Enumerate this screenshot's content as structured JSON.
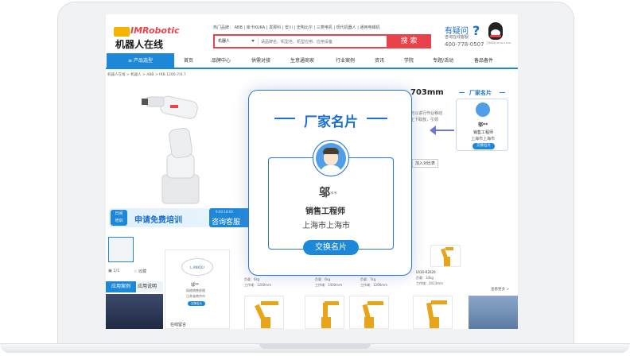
{
  "site": {
    "logo_brand": "IMRobotic",
    "logo_cn": "机器人在线",
    "hot_label": "热门品牌：",
    "hot_brands": [
      "ABB",
      "库卡KUKA",
      "发那科",
      "安川",
      "史陶比尔",
      "三菱电机",
      "现代机器人",
      "通用电梯机"
    ],
    "search_category": "机器人",
    "search_placeholder": "请品牌名、机型名、机型应用、应用设备",
    "search_button": "搜 索",
    "help_title": "有疑问",
    "help_sub": "咨询在线客服",
    "help_phone": "400-778-0507",
    "qq_label": "工作时间 09:00-18:00"
  },
  "nav": {
    "category": "产品选型",
    "items": [
      "首页",
      "品牌中心",
      "供需对接",
      "生意通商家",
      "行业案例",
      "资讯",
      "学院",
      "专题/活动",
      "备品备件"
    ]
  },
  "breadcrumb": "机器人在线 > 机器人 > ABB > IRB 1200-7/0.7",
  "product": {
    "title_partial": "703mm",
    "desc_line1": "可以进行作业移动",
    "desc_line2": "上下取放，引领",
    "compare_label": "加入对比表",
    "thumb_prev": "1/1",
    "share": "分享",
    "favorite": "收藏"
  },
  "promo": {
    "badge": "日间\n培训",
    "text": "申请免费培训",
    "cs_time": "9:00-18:00",
    "cs_label": "咨询客服"
  },
  "side_card": {
    "heading": "厂家名片",
    "name": "邬**",
    "role": "销售工程师",
    "city": "上海市上海市",
    "button": "交换名片"
  },
  "modal": {
    "heading": "厂家名片",
    "name": "邬",
    "name_mask": "**",
    "role": "销售工程师",
    "city": "上海市上海市",
    "button": "交换名片"
  },
  "lower": {
    "cases_tab": "应用案例",
    "cases_tab2": "应用说明",
    "vendor_logo": "L.ANKOU",
    "vendor_name": "邬**",
    "vendor_line1": "网络销售经理",
    "vendor_line2": "江苏省南京市",
    "vendor_button": "交换名片",
    "vendor_more": "在线留言",
    "more": "查看更多 >",
    "products": [
      {
        "spec1": "负载：6kg",
        "spec2": "工作域：1200mm"
      },
      {
        "spec1": "负载：6kg",
        "spec2": "工作域：1400mm"
      },
      {
        "spec1": "负载：7kg",
        "spec2": "工作域：1200mm"
      },
      {
        "spec1": "LR10-R2020",
        "spec2": "负载：10kg",
        "spec3": "工作域：2023mm"
      }
    ]
  },
  "colors": {
    "brand_blue": "#1e88d8",
    "accent_red": "#e8434a",
    "modal_blue": "#2a74d4"
  }
}
